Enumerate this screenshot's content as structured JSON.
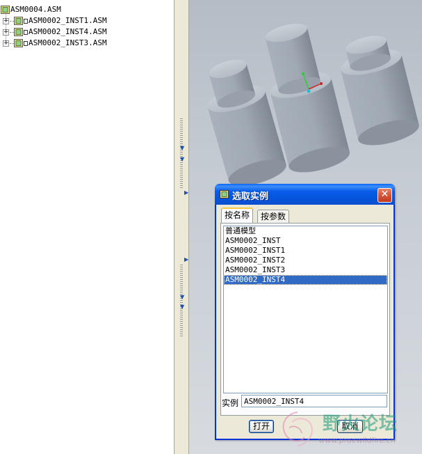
{
  "model_tree": {
    "root": {
      "label": "ASM0004.ASM"
    },
    "children": [
      {
        "label": "ASM0002_INST1.ASM",
        "expander": "+"
      },
      {
        "label": "ASM0002_INST4.ASM",
        "expander": "+"
      },
      {
        "label": "ASM0002_INST3.ASM",
        "expander": "+"
      }
    ]
  },
  "dialog": {
    "title": "选取实例",
    "close_label": "✕",
    "tabs": [
      {
        "label": "按名称",
        "active": true
      },
      {
        "label": "按参数",
        "active": false
      }
    ],
    "instances": [
      {
        "label": "普通模型"
      },
      {
        "label": "ASM0002_INST"
      },
      {
        "label": "ASM0002_INST1"
      },
      {
        "label": "ASM0002_INST2"
      },
      {
        "label": "ASM0002_INST3"
      },
      {
        "label": "ASM0002_INST4",
        "selected": true
      }
    ],
    "instance_field_label": "实例",
    "instance_field_value": "ASM0002_INST4",
    "open_label": "打开",
    "cancel_label": "取消"
  },
  "watermark": {
    "title": "野火论坛",
    "url": "www.proewildfire.cn"
  },
  "colors": {
    "title_bar": "#0a5ce9",
    "selection": "#316ac5",
    "viewport_bg": "#c6ccd3",
    "cylinder": "#a4adb7"
  }
}
